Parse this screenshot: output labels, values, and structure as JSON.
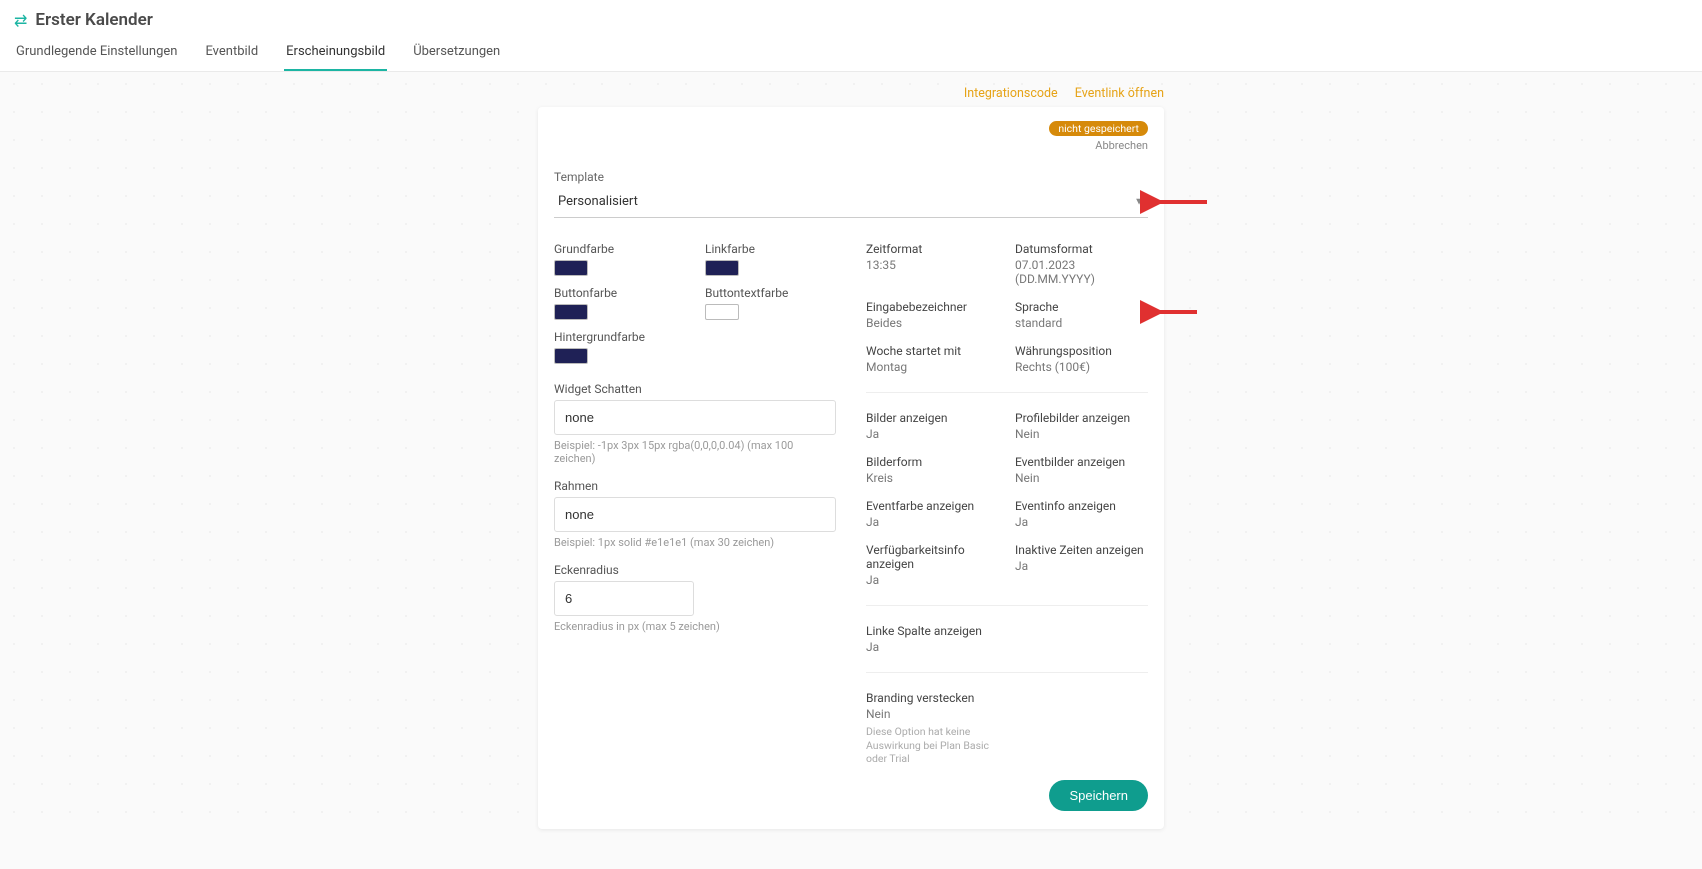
{
  "header": {
    "title": "Erster Kalender",
    "tabs": {
      "basic": "Grundlegende Einstellungen",
      "eventimg": "Eventbild",
      "appearance": "Erscheinungsbild",
      "translations": "Übersetzungen"
    },
    "active_tab": "appearance"
  },
  "top_links": {
    "integration": "Integrationscode",
    "eventlink": "Eventlink öffnen"
  },
  "card": {
    "badge": "nicht gespeichert",
    "cancel": "Abbrechen",
    "template_label": "Template",
    "template_value": "Personalisiert",
    "save": "Speichern"
  },
  "colors": {
    "base": {
      "label": "Grundfarbe",
      "value": "#1f2156"
    },
    "link": {
      "label": "Linkfarbe",
      "value": "#1f2156"
    },
    "button": {
      "label": "Buttonfarbe",
      "value": "#1f2156"
    },
    "buttontext": {
      "label": "Buttontextfarbe",
      "value": "#ffffff"
    },
    "background": {
      "label": "Hintergrundfarbe",
      "value": "#1f2156"
    }
  },
  "fields": {
    "widget_shadow": {
      "label": "Widget Schatten",
      "value": "none",
      "helper": "Beispiel: -1px 3px 15px rgba(0,0,0,0.04) (max 100 zeichen)"
    },
    "border": {
      "label": "Rahmen",
      "value": "none",
      "helper": "Beispiel: 1px solid #e1e1e1 (max 30 zeichen)"
    },
    "radius": {
      "label": "Eckenradius",
      "value": "6",
      "helper": "Eckenradius in px (max 5 zeichen)"
    }
  },
  "settings": {
    "time_format": {
      "k": "Zeitformat",
      "v": "13:35"
    },
    "date_format": {
      "k": "Datumsformat",
      "v": "07.01.2023 (DD.MM.YYYY)"
    },
    "input_label": {
      "k": "Eingabebezeichner",
      "v": "Beides"
    },
    "language": {
      "k": "Sprache",
      "v": "standard"
    },
    "week_start": {
      "k": "Woche startet mit",
      "v": "Montag"
    },
    "currency_pos": {
      "k": "Währungsposition",
      "v": "Rechts (100€)"
    },
    "show_images": {
      "k": "Bilder anzeigen",
      "v": "Ja"
    },
    "show_profile_img": {
      "k": "Profilebilder anzeigen",
      "v": "Nein"
    },
    "image_shape": {
      "k": "Bilderform",
      "v": "Kreis"
    },
    "show_event_img": {
      "k": "Eventbilder anzeigen",
      "v": "Nein"
    },
    "show_event_color": {
      "k": "Eventfarbe anzeigen",
      "v": "Ja"
    },
    "show_event_info": {
      "k": "Eventinfo anzeigen",
      "v": "Ja"
    },
    "show_availability": {
      "k": "Verfügbarkeitsinfo anzeigen",
      "v": "Ja"
    },
    "show_inactive": {
      "k": "Inaktive Zeiten anzeigen",
      "v": "Ja"
    },
    "show_left_col": {
      "k": "Linke Spalte anzeigen",
      "v": "Ja"
    },
    "hide_branding": {
      "k": "Branding verstecken",
      "v": "Nein"
    },
    "branding_note": "Diese Option hat keine Auswirkung bei Plan Basic oder Trial"
  }
}
